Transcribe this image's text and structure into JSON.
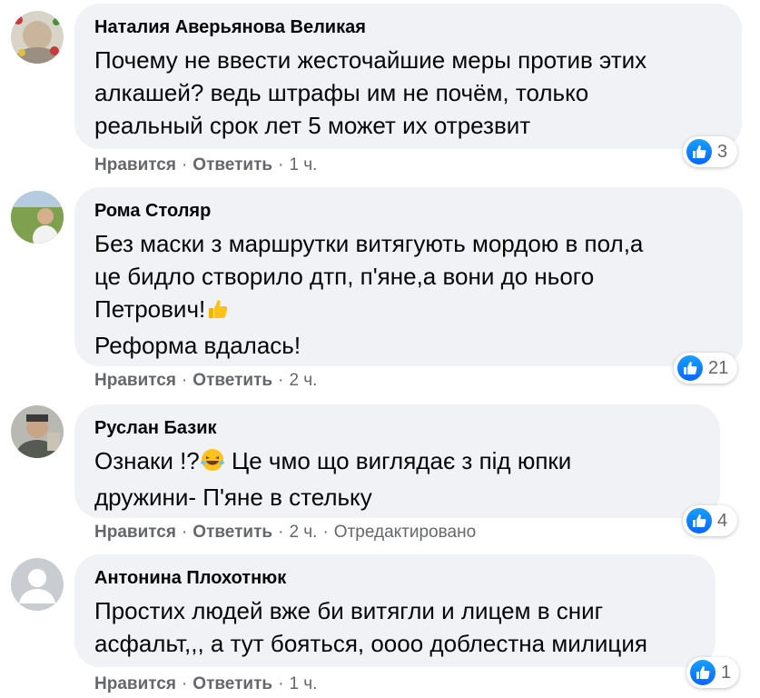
{
  "labels": {
    "like": "Нравится",
    "reply": "Ответить",
    "dot": "·"
  },
  "comments": [
    {
      "author": "Наталия Аверьянова Великая",
      "lines": [
        "Почему не ввести жесточайшие меры против этих",
        "алкашей? ведь штрафы им не почём, только",
        "реальный срок лет 5 может их отрезвит"
      ],
      "time": "1 ч.",
      "reactions": "3"
    },
    {
      "author": "Рома Столяр",
      "lines": [
        "Без маски з маршрутки витягують мордою в пол,а",
        "це бидло створило дтп, п'яне,а вони до нього",
        "Петрович!",
        "Реформа вдалась!"
      ],
      "time": "2 ч.",
      "reactions": "21"
    },
    {
      "author": "Руслан Базик",
      "line1_pre": "Ознаки !?",
      "line1_post": " Це чмо що виглядає з під юпки",
      "line2": "дружини- П'яне в стельку",
      "time": "2 ч.",
      "edited": "Отредактировано",
      "reactions": "4"
    },
    {
      "author": "Антонина Плохотнюк",
      "lines": [
        "Простих людей вже би витягли и лицем в сниг",
        "асфальт,,, а тут бояться, оооо доблестна милиция"
      ],
      "time": "1 ч.",
      "reactions": "1"
    }
  ],
  "colors": {
    "bubble": "#f0f2f5",
    "meta": "#65676b",
    "like": "#0866ff"
  },
  "icons": {
    "like": "thumbs-up-icon",
    "thumb_emoji": "thumbs-up-emoji",
    "laugh_emoji": "laughing-emoji"
  }
}
